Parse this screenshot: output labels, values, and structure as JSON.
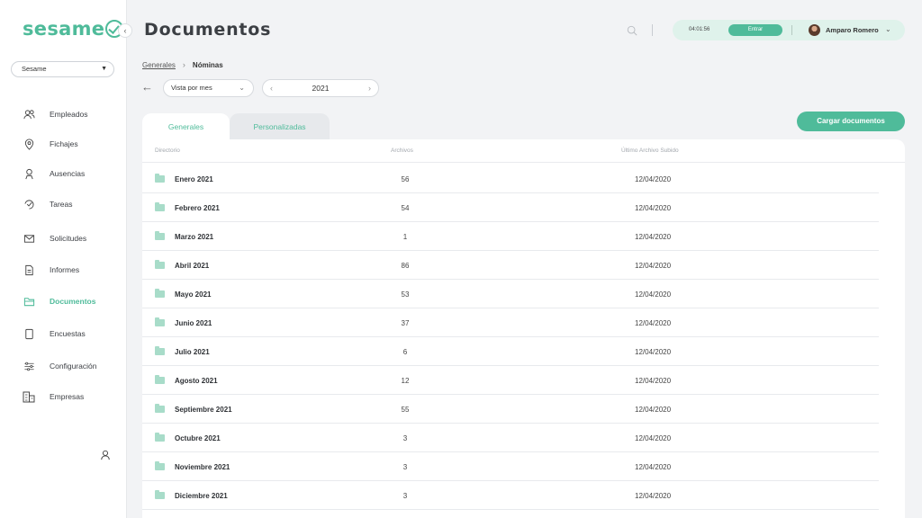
{
  "app": {
    "logo_text": "sesame",
    "collapse_icon": "chevron-left-icon",
    "company_selector": {
      "value": "Sesame"
    }
  },
  "sidebar": {
    "items": [
      {
        "label": "Empleados",
        "icon": "users-icon",
        "active": false
      },
      {
        "label": "Fichajes",
        "icon": "location-pin-icon",
        "active": false
      },
      {
        "label": "Ausencias",
        "icon": "person-absence-icon",
        "active": false
      },
      {
        "label": "Tareas",
        "icon": "task-icon",
        "active": false
      },
      {
        "label": "Solicitudes",
        "icon": "mail-icon",
        "active": false
      },
      {
        "label": "Informes",
        "icon": "document-icon",
        "active": false
      },
      {
        "label": "Documentos",
        "icon": "folder-icon",
        "active": true
      },
      {
        "label": "Encuestas",
        "icon": "clipboard-icon",
        "active": false
      },
      {
        "label": "Configuración",
        "icon": "sliders-icon",
        "active": false
      },
      {
        "label": "Empresas",
        "icon": "building-icon",
        "active": false
      }
    ],
    "footer_icon": "user-icon"
  },
  "header": {
    "title": "Documentos",
    "clock": {
      "time": "04:01:56",
      "button_label": "Entrar"
    },
    "user": {
      "name": "Amparo Romero"
    }
  },
  "breadcrumb": {
    "parent": "Generales",
    "current": "Nóminas"
  },
  "filters": {
    "view": "Vista por mes",
    "year": "2021"
  },
  "tabs": [
    {
      "label": "Generales",
      "active": true
    },
    {
      "label": "Personalizadas",
      "active": false
    }
  ],
  "upload_button": "Cargar documentos",
  "table": {
    "headers": {
      "directory": "Directorio",
      "files": "Archivos",
      "last_uploaded": "Último Archivo Subido"
    },
    "rows": [
      {
        "name": "Enero 2021",
        "files": "56",
        "date": "12/04/2020"
      },
      {
        "name": "Febrero 2021",
        "files": "54",
        "date": "12/04/2020"
      },
      {
        "name": "Marzo 2021",
        "files": "1",
        "date": "12/04/2020"
      },
      {
        "name": "Abril 2021",
        "files": "86",
        "date": "12/04/2020"
      },
      {
        "name": "Mayo 2021",
        "files": "53",
        "date": "12/04/2020"
      },
      {
        "name": "Junio 2021",
        "files": "37",
        "date": "12/04/2020"
      },
      {
        "name": "Julio 2021",
        "files": "6",
        "date": "12/04/2020"
      },
      {
        "name": "Agosto 2021",
        "files": "12",
        "date": "12/04/2020"
      },
      {
        "name": "Septiembre 2021",
        "files": "55",
        "date": "12/04/2020"
      },
      {
        "name": "Octubre 2021",
        "files": "3",
        "date": "12/04/2020"
      },
      {
        "name": "Noviembre 2021",
        "files": "3",
        "date": "12/04/2020"
      },
      {
        "name": "Diciembre 2021",
        "files": "3",
        "date": "12/04/2020"
      }
    ]
  },
  "colors": {
    "accent": "#4fbb9a",
    "accent_light": "#dff2eb",
    "background": "#f2f3f5"
  }
}
